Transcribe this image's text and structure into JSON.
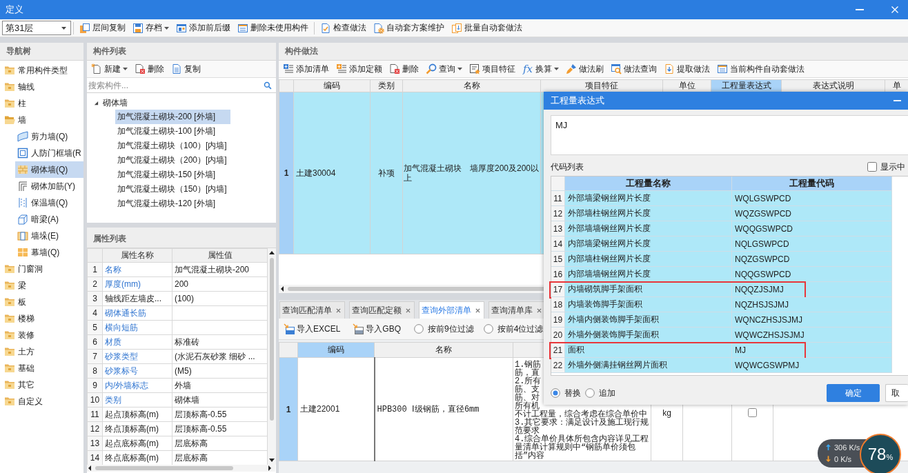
{
  "window": {
    "title": "定义"
  },
  "toolbar": {
    "floor": {
      "value": "第31层"
    },
    "groups": [
      [
        {
          "label": "层间复制",
          "dropdown": false
        },
        {
          "label": "存档",
          "dropdown": true
        },
        {
          "label": "添加前后缀",
          "dropdown": false
        },
        {
          "label": "删除未使用构件",
          "dropdown": false
        }
      ],
      [
        {
          "label": "检查做法",
          "dropdown": false
        },
        {
          "label": "自动套方案维护",
          "dropdown": false
        },
        {
          "label": "批量自动套做法",
          "dropdown": false
        }
      ]
    ]
  },
  "nav_tree": {
    "title": "导航树",
    "items": [
      {
        "label": "常用构件类型",
        "expanded": false,
        "selected": false
      },
      {
        "label": "轴线",
        "expanded": false,
        "selected": false
      },
      {
        "label": "柱",
        "expanded": false,
        "selected": false
      },
      {
        "label": "墙",
        "expanded": true,
        "selected": false,
        "children": [
          {
            "label": "剪力墙(Q)",
            "selected": false
          },
          {
            "label": "人防门框墙(R",
            "selected": false
          },
          {
            "label": "砌体墙(Q)",
            "selected": true
          },
          {
            "label": "砌体加筋(Y)",
            "selected": false
          },
          {
            "label": "保温墙(Q)",
            "selected": false
          },
          {
            "label": "暗梁(A)",
            "selected": false
          },
          {
            "label": "墙垛(E)",
            "selected": false
          },
          {
            "label": "幕墙(Q)",
            "selected": false
          }
        ]
      },
      {
        "label": "门窗洞",
        "expanded": false,
        "selected": false
      },
      {
        "label": "梁",
        "expanded": false,
        "selected": false
      },
      {
        "label": "板",
        "expanded": false,
        "selected": false
      },
      {
        "label": "楼梯",
        "expanded": false,
        "selected": false
      },
      {
        "label": "装修",
        "expanded": false,
        "selected": false
      },
      {
        "label": "土方",
        "expanded": false,
        "selected": false
      },
      {
        "label": "基础",
        "expanded": false,
        "selected": false
      },
      {
        "label": "其它",
        "expanded": false,
        "selected": false
      },
      {
        "label": "自定义",
        "expanded": false,
        "selected": false
      }
    ]
  },
  "component_list": {
    "title": "构件列表",
    "toolbar": [
      {
        "label": "新建",
        "dropdown": true
      },
      {
        "label": "删除",
        "dropdown": false
      },
      {
        "label": "复制",
        "dropdown": false
      }
    ],
    "search": {
      "placeholder": "搜索构件..."
    },
    "groups": [
      {
        "label": "砌体墙",
        "expanded": true,
        "children": [
          {
            "label": "加气混凝土砌块-200 [外墙]",
            "selected": true
          },
          {
            "label": "加气混凝土砌块-100 [外墙]",
            "selected": false
          },
          {
            "label": "加气混凝土砌块（100）[内墙]",
            "selected": false
          },
          {
            "label": "加气混凝土砌块（200）[内墙]",
            "selected": false
          },
          {
            "label": "加气混凝土砌块-150 [外墙]",
            "selected": false
          },
          {
            "label": "加气混凝土砌块（150）[内墙]",
            "selected": false
          },
          {
            "label": "加气混凝土砌块-120 [外墙]",
            "selected": false
          }
        ]
      }
    ]
  },
  "property_list": {
    "title": "属性列表",
    "columns": [
      "属性名称",
      "属性值"
    ],
    "rows": [
      {
        "index": "1",
        "name": "名称",
        "public": true,
        "value": "加气混凝土砌块-200"
      },
      {
        "index": "2",
        "name": "厚度(mm)",
        "public": true,
        "value": "200"
      },
      {
        "index": "3",
        "name": "轴线距左墙皮...",
        "public": false,
        "value": "(100)"
      },
      {
        "index": "4",
        "name": "砌体通长筋",
        "public": true
      },
      {
        "index": "5",
        "name": "横向短筋",
        "public": true
      },
      {
        "index": "6",
        "name": "材质",
        "public": true,
        "value": "标准砖"
      },
      {
        "index": "7",
        "name": "砂浆类型",
        "public": true,
        "value": "(水泥石灰砂浆 细砂 ..."
      },
      {
        "index": "8",
        "name": "砂浆标号",
        "public": true,
        "value": "(M5)"
      },
      {
        "index": "9",
        "name": "内/外墙标志",
        "public": true,
        "value": "外墙"
      },
      {
        "index": "10",
        "name": "类别",
        "public": true,
        "value": "砌体墙"
      },
      {
        "index": "11",
        "name": "起点顶标高(m)",
        "public": false,
        "value": "层顶标高-0.55"
      },
      {
        "index": "12",
        "name": "终点顶标高(m)",
        "public": false,
        "value": "层顶标高-0.55"
      },
      {
        "index": "13",
        "name": "起点底标高(m)",
        "public": false,
        "value": "层底标高"
      },
      {
        "index": "14",
        "name": "终点底标高(m)",
        "public": false,
        "value": "层底标高"
      }
    ]
  },
  "method_panel": {
    "title": "构件做法",
    "toolbar": [
      {
        "label": "添加清单",
        "dropdown": false
      },
      {
        "label": "添加定额",
        "dropdown": false
      },
      {
        "label": "删除",
        "dropdown": false
      },
      {
        "label": "查询",
        "dropdown": true
      },
      {
        "label": "项目特征",
        "dropdown": false
      },
      {
        "label": "换算",
        "dropdown": true,
        "symbol": "fx"
      },
      {
        "label": "做法刷",
        "dropdown": false
      },
      {
        "label": "做法查询",
        "dropdown": false
      },
      {
        "label": "提取做法",
        "dropdown": false
      },
      {
        "label": "当前构件自动套做法",
        "dropdown": false
      }
    ],
    "columns": [
      {
        "label": "编码",
        "selected": false
      },
      {
        "label": "类别",
        "selected": false
      },
      {
        "label": "名称",
        "selected": false
      },
      {
        "label": "项目特征",
        "selected": false
      },
      {
        "label": "单位",
        "selected": false
      },
      {
        "label": "工程量表达式",
        "selected": true
      },
      {
        "label": "表达式说明",
        "selected": false
      },
      {
        "label": "单",
        "selected": false
      }
    ],
    "rows": [
      {
        "index": "1",
        "code": "土建30004",
        "category": "补项",
        "name": "加气混凝土砌块　墙厚度200及200以上",
        "selected": true
      }
    ]
  },
  "query_panel": {
    "tabs": [
      {
        "label": "查询匹配清单",
        "selected": false
      },
      {
        "label": "查询匹配定额",
        "selected": false
      },
      {
        "label": "查询外部清单",
        "selected": true
      },
      {
        "label": "查询清单库",
        "selected": false
      }
    ],
    "actions": [
      {
        "label": "导入EXCEL"
      },
      {
        "label": "导入GBQ"
      }
    ],
    "filters": [
      {
        "label": "按前9位过滤",
        "selected": false
      },
      {
        "label": "按前4位过滤",
        "selected": false
      }
    ],
    "columns": [
      {
        "label": "编码",
        "selected": true
      },
      {
        "label": "名称",
        "selected": false
      }
    ],
    "rows": [
      {
        "index": "1",
        "code": "土建22001",
        "name": "HPB300 Ⅰ级钢筋，直径6mm",
        "description": [
          "1.钢筋",
          "筋，直",
          "2.所有",
          "筋、支",
          "筋、对",
          "所有机",
          "不计工程量，综合考虑在综合单价中",
          "3.其它要求：满足设计及施工现行规",
          "范要求",
          "4.综合单价具体所包含内容详见工程",
          "量清单计算规则中“钢筋单价须包",
          "括”内容"
        ],
        "unit": "kg",
        "checked": false,
        "selected": true
      }
    ]
  },
  "dialog": {
    "title": "工程量表达式",
    "expression": "MJ",
    "list_label": "代码列表",
    "show_option": {
      "label": "显示中",
      "checked": false
    },
    "columns": [
      "工程量名称",
      "工程量代码"
    ],
    "rows": [
      {
        "index": "11",
        "name": "外部墙梁钢丝网片长度",
        "code": "WQLGSWPCD",
        "marked": false
      },
      {
        "index": "12",
        "name": "外部墙柱钢丝网片长度",
        "code": "WQZGSWPCD",
        "marked": false
      },
      {
        "index": "13",
        "name": "外部墙墙钢丝网片长度",
        "code": "WQQGSWPCD",
        "marked": false
      },
      {
        "index": "14",
        "name": "内部墙梁钢丝网片长度",
        "code": "NQLGSWPCD",
        "marked": false
      },
      {
        "index": "15",
        "name": "内部墙柱钢丝网片长度",
        "code": "NQZGSWPCD",
        "marked": false
      },
      {
        "index": "16",
        "name": "内部墙墙钢丝网片长度",
        "code": "NQQGSWPCD",
        "marked": false
      },
      {
        "index": "17",
        "name": "内墙砌筑脚手架面积",
        "code": "NQQZJSJMJ",
        "marked": true
      },
      {
        "index": "18",
        "name": "内墙装饰脚手架面积",
        "code": "NQZHSJSJMJ",
        "marked": false
      },
      {
        "index": "19",
        "name": "外墙内侧装饰脚手架面积",
        "code": "WQNCZHSJSJMJ",
        "marked": false
      },
      {
        "index": "20",
        "name": "外墙外侧装饰脚手架面积",
        "code": "WQWCZHSJSJMJ",
        "marked": false
      },
      {
        "index": "21",
        "name": "面积",
        "code": "MJ",
        "marked": true
      },
      {
        "index": "22",
        "name": "外墙外侧满挂钢丝网片面积",
        "code": "WQWCGSWPMJ",
        "marked": false
      }
    ],
    "modes": [
      {
        "label": "替换",
        "selected": true
      },
      {
        "label": "追加",
        "selected": false
      }
    ],
    "buttons": [
      {
        "label": "确定",
        "primary": true
      },
      {
        "label": "取",
        "primary": false
      }
    ]
  },
  "speed_widget": {
    "upload": "306 K/s",
    "download": "0 K/s",
    "value": "78",
    "unit": "%"
  }
}
